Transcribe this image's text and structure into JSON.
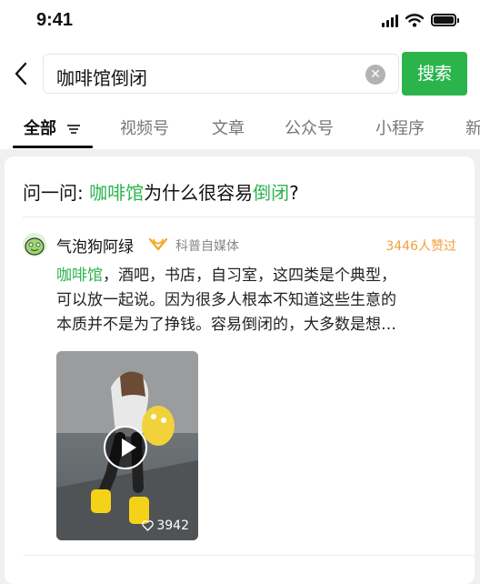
{
  "status_bar": {
    "time": "9:41",
    "icons": [
      "signal-icon",
      "wifi-icon",
      "battery-icon"
    ]
  },
  "search": {
    "query": "咖啡馆倒闭",
    "button_label": "搜索",
    "icons": [
      "back-arrow-icon",
      "clear-icon"
    ]
  },
  "tabs": [
    {
      "label": "全部",
      "active": true
    },
    {
      "label": "视频号",
      "active": false
    },
    {
      "label": "文章",
      "active": false
    },
    {
      "label": "公众号",
      "active": false
    },
    {
      "label": "小程序",
      "active": false
    },
    {
      "label": "新",
      "active": false
    }
  ],
  "ask": {
    "prefix": "问一问: ",
    "keyword1": "咖啡馆",
    "middle": "为什么很容易",
    "keyword2": "倒闭",
    "suffix": "?"
  },
  "result": {
    "author": "气泡狗阿绿",
    "author_type": "科普自媒体",
    "likes": "3446人赞过",
    "excerpt_keyword": "咖啡馆",
    "excerpt_line1_rest": "，酒吧，书店，自习室，这四类是个典型，",
    "excerpt_line2": "可以放一起说。因为很多人根本不知道这些生意的",
    "excerpt_line3": "本质并不是为了挣钱。容易倒闭的，大多数是想…",
    "video_likes": "3942"
  },
  "colors": {
    "accent_green": "#2bb44c",
    "likes_orange": "#f0a03c",
    "badge_orange": "#f5a623"
  }
}
